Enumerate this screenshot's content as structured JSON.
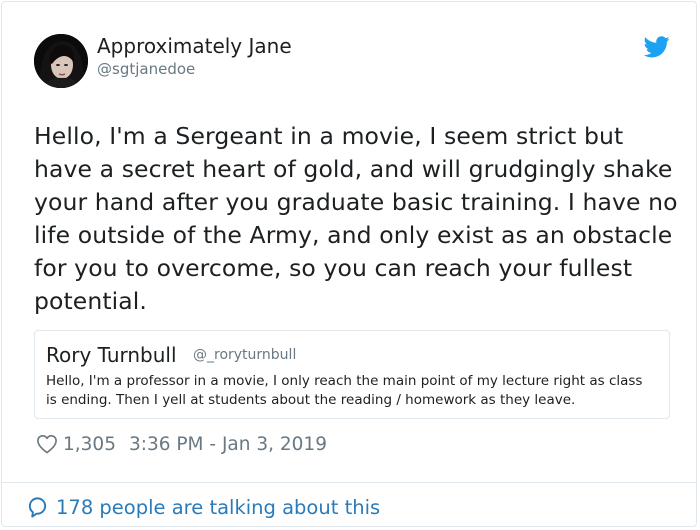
{
  "author": {
    "name": "Approximately Jane",
    "handle": "@sgtjanedoe"
  },
  "icons": {
    "avatar": "avatar-photo",
    "brand": "twitter-bird-icon",
    "like": "heart-icon",
    "conversation": "speech-bubble-icon"
  },
  "tweet": {
    "text": "Hello, I'm a Sergeant in a movie, I seem strict but have a secret heart of gold, and will grudgingly shake your hand after you graduate basic training. I have no life outside of the Army, and only exist as an obstacle for you to overcome, so you can reach your fullest potential."
  },
  "quoted_tweet": {
    "name": "Rory Turnbull",
    "handle": "@_roryturnbull",
    "text": "Hello, I'm a professor in a movie, I only reach the main point of my lecture right as class is ending. Then I yell at students about the reading / homework as they leave."
  },
  "meta": {
    "likes": "1,305",
    "timestamp": "3:36 PM - Jan 3, 2019"
  },
  "footer": {
    "talking_text": "178 people are talking about this"
  },
  "colors": {
    "brand_blue": "#1da1f2",
    "link_blue": "#2b7bb9",
    "secondary_text": "#697882",
    "border": "#e1e8ed"
  }
}
